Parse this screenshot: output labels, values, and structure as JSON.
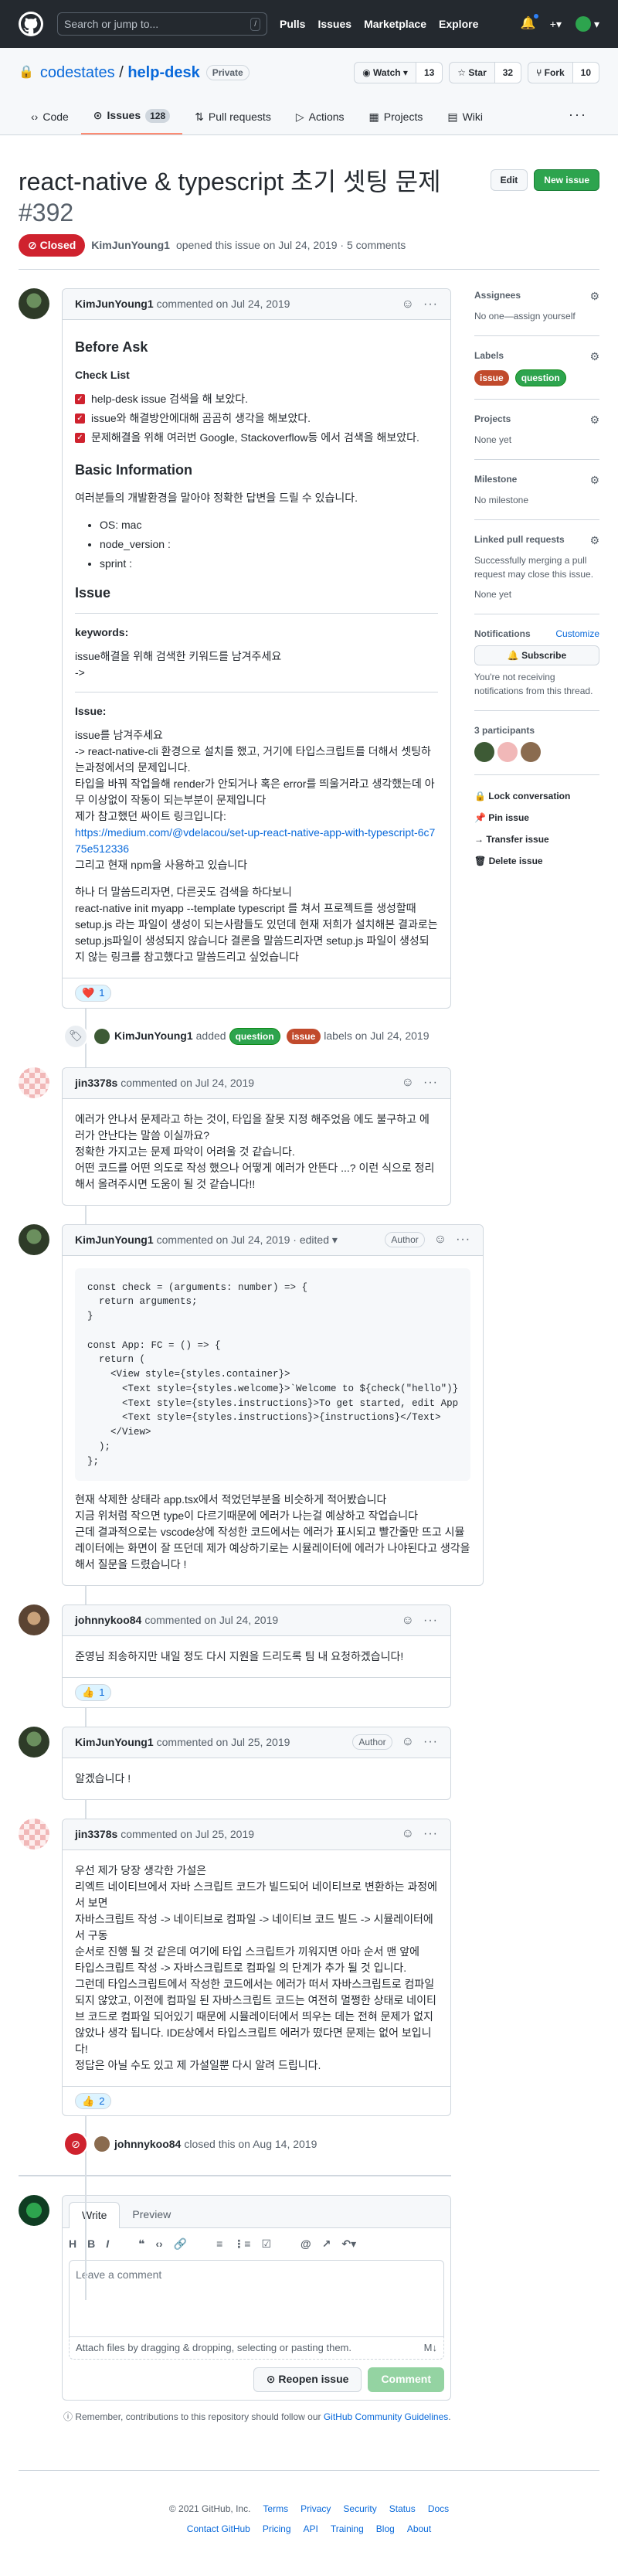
{
  "header": {
    "search_placeholder": "Search or jump to...",
    "slash": "/",
    "nav": [
      "Pulls",
      "Issues",
      "Marketplace",
      "Explore"
    ],
    "plus": "+▾",
    "avatar_caret": "▾"
  },
  "repo": {
    "owner": "codestates",
    "sep": " / ",
    "name": "help-desk",
    "visibility": "Private",
    "watch_label": "◉ Watch ▾",
    "watch_count": "13",
    "star_label": "☆ Star",
    "star_count": "32",
    "fork_label": "⑂ Fork",
    "fork_count": "10",
    "tabs": [
      {
        "icon": "‹›",
        "label": "Code"
      },
      {
        "icon": "⊙",
        "label": "Issues",
        "count": "128"
      },
      {
        "icon": "⇅",
        "label": "Pull requests"
      },
      {
        "icon": "▷",
        "label": "Actions"
      },
      {
        "icon": "▦",
        "label": "Projects"
      },
      {
        "icon": "▤",
        "label": "Wiki"
      }
    ],
    "more": "···"
  },
  "issue": {
    "title": "react-native & typescript 초기 셋팅 문제",
    "number": "#392",
    "edit_label": "Edit",
    "new_label": "New issue",
    "state": "⊘ Closed",
    "author": "KimJunYoung1",
    "meta": "opened this issue on Jul 24, 2019 · 5 comments"
  },
  "comments": {
    "c1": {
      "author": "KimJunYoung1",
      "meta": "commented on Jul 24, 2019",
      "h_before": "Before Ask",
      "h_check": "Check List",
      "checks": [
        "help-desk issue 검색을 해 보았다.",
        "issue와 해결방안에대해 곰곰히 생각을 해보았다.",
        "문제해결을 위해 여러번 Google, Stackoverflow등 에서 검색을 해보았다."
      ],
      "h_basic": "Basic Information",
      "basic_intro": "여러분들의 개발환경을 말아야 정확한 답변을 드릴 수 있습니다.",
      "basic_list": [
        "OS: mac",
        "node_version :",
        "sprint :"
      ],
      "h_issue": "Issue",
      "h_keywords": "keywords:",
      "keywords_text": "issue해결을 위해 검색한 키워드를 남겨주세요\n->",
      "h_issue2": "Issue:",
      "issue_text1": "issue를 남겨주세요\n-> react-native-cli 환경으로 설치를 했고, 거기에 타입스크립트를 더해서 셋팅하는과정에서의 문제입니다.\n타입을 바꿔 작업을해 render가 안되거나 혹은 error를 띄울거라고 생각했는데 아무 이상없이 작동이 되는부분이 문제입니다\n제가 참고했던 싸이트 링크입니다:",
      "issue_link": "https://medium.com/@vdelacou/set-up-react-native-app-with-typescript-6c775e512336",
      "issue_text2": "그리고 현재 npm을 사용하고 있습니다",
      "issue_text3": "하나 더 말씀드리자면, 다른곳도 검색을 하다보니\nreact-native init myapp --template typescript 를 쳐서 프로젝트를 생성할때 setup.js 라는 파일이 생성이 되는사람들도 있던데 현재 저희가 설치해본 결과로는 setup.js파일이 생성되지 않습니다 결론을 말씀드리자면 setup.js 파일이 생성되지 않는 링크를 참고했다고 말씀드리고 싶었습니다",
      "reaction": "❤️",
      "reaction_count": "1"
    },
    "labels_event": {
      "author": "KimJunYoung1",
      "pre": "added",
      "label_q": "question",
      "label_i": "issue",
      "post": "labels on Jul 24, 2019"
    },
    "c2": {
      "author": "jin3378s",
      "meta": "commented on Jul 24, 2019",
      "body": "에러가 안나서 문제라고 하는 것이, 타입을 잘못 지정 해주었음 에도 불구하고 에러가 안난다는 말씀 이실까요?\n정확한 가지고는 문제 파악이 어려울 것 같습니다.\n어떤 코드를 어떤 의도로 작성 했으나 어떻게 에러가 안뜬다 ...? 이런 식으로 정리해서 올려주시면 도움이 될 것 같습니다!!"
    },
    "c3": {
      "author": "KimJunYoung1",
      "meta": "commented on Jul 24, 2019 · edited ▾",
      "badge": "Author",
      "code": "const check = (arguments: number) => {\n  return arguments;\n}\n\nconst App: FC = () => {\n  return (\n    <View style={styles.container}>\n      <Text style={styles.welcome}>`Welcome to ${check(\"hello\")}\n      <Text style={styles.instructions}>To get started, edit App\n      <Text style={styles.instructions}>{instructions}</Text>\n    </View>\n  );\n};",
      "body": "현재 삭제한 상태라 app.tsx에서 적었던부분을 비슷하게 적어봤습니다\n지금 위처럼 작으면 type이 다르기때문에 에러가 나는걸 예상하고 작업습니다\n근데 결과적으로는 vscode상에 작성한 코드에서는 에러가 표시되고 빨간줄만 뜨고 시뮬레이터에는 화면이 잘 뜨던데 제가 예상하기로는 시뮬레이터에 에러가 나야된다고 생각을 해서 질문을 드렸습니다 !"
    },
    "c4": {
      "author": "johnnykoo84",
      "meta": "commented on Jul 24, 2019",
      "body": "준영님 죄송하지만 내일 정도 다시 지원을 드리도록 팀 내 요청하겠습니다!",
      "reaction": "👍",
      "reaction_count": "1"
    },
    "c5": {
      "author": "KimJunYoung1",
      "meta": "commented on Jul 25, 2019",
      "badge": "Author",
      "body": "알겠습니다 !"
    },
    "c6": {
      "author": "jin3378s",
      "meta": "commented on Jul 25, 2019",
      "body": "우선 제가 당장 생각한 가설은\n리엑트 네이티브에서 자바 스크립트 코드가 빌드되어 네이티브로 변환하는 과정에서 보면\n자바스크립트 작성 -> 네이티브로 컴파일 -> 네이티브 코드 빌드 -> 시뮬레이터에서 구동\n순서로 진행 될 것 같은데 여기에 타입 스크립트가 끼워지면 아마 순서 맨 앞에\n타입스크립트 작성 -> 자바스크립트로 컴파일 의 단계가 추가 될 것 입니다.\n그런데 타입스크립트에서 작성한 코드에서는 에러가 떠서 자바스크립트로 컴파일 되지 않았고, 이전에 컴파일 된 자바스크립트 코드는 여전히 멀쩡한 상태로 네이티브 코드로 컴파일 되어있기 때문에 시뮬레이터에서 띄우는 데는 전혀 문제가 없지 않았나 생각 됩니다. IDE상에서 타입스크립트 에러가 떴다면 문제는 없어 보입니다!\n정답은 아닐 수도 있고 제 가설일뿐 다시 알려 드립니다.",
      "reaction": "👍",
      "reaction_count": "2"
    },
    "closed_event": {
      "author": "johnnykoo84",
      "text": "closed this on Aug 14, 2019"
    }
  },
  "composer": {
    "tab_write": "Write",
    "tab_preview": "Preview",
    "tools": [
      "H",
      "B",
      "I",
      "❝",
      "‹›",
      "🔗",
      "≡",
      "⋮≡",
      "☑",
      "@",
      "↗",
      "↶▾"
    ],
    "placeholder": "Leave a comment",
    "attach": "Attach files by dragging & dropping, selecting or pasting them.",
    "md": "M↓",
    "reopen": "⊙ Reopen issue",
    "comment": "Comment",
    "tip_pre": "ⓘ Remember, contributions to this repository should follow our",
    "tip_link": "GitHub Community Guidelines",
    "tip_post": "."
  },
  "sidebar": {
    "assignees_title": "Assignees",
    "assignees_value": "No one—assign yourself",
    "labels_title": "Labels",
    "label_i": "issue",
    "label_q": "question",
    "projects_title": "Projects",
    "projects_value": "None yet",
    "milestone_title": "Milestone",
    "milestone_value": "No milestone",
    "linked_title": "Linked pull requests",
    "linked_desc": "Successfully merging a pull request may close this issue.",
    "linked_value": "None yet",
    "notif_title": "Notifications",
    "notif_customize": "Customize",
    "subscribe": "🔔 Subscribe",
    "notif_desc": "You're not receiving notifications from this thread.",
    "participants_title": "3 participants",
    "lock": "🔒 Lock conversation",
    "pin": "📌 Pin issue",
    "transfer": "→ Transfer issue",
    "delete": "🗑 Delete issue"
  },
  "footer": {
    "copyright": "© 2021 GitHub, Inc.",
    "row1": [
      "Terms",
      "Privacy",
      "Security",
      "Status",
      "Docs"
    ],
    "row2": [
      "Contact GitHub",
      "Pricing",
      "API",
      "Training",
      "Blog",
      "About"
    ]
  },
  "colors": {
    "closed": "#cf222e",
    "label_issue": "#c14a2c",
    "label_question": "#2da44e",
    "primary": "#2da44e"
  }
}
